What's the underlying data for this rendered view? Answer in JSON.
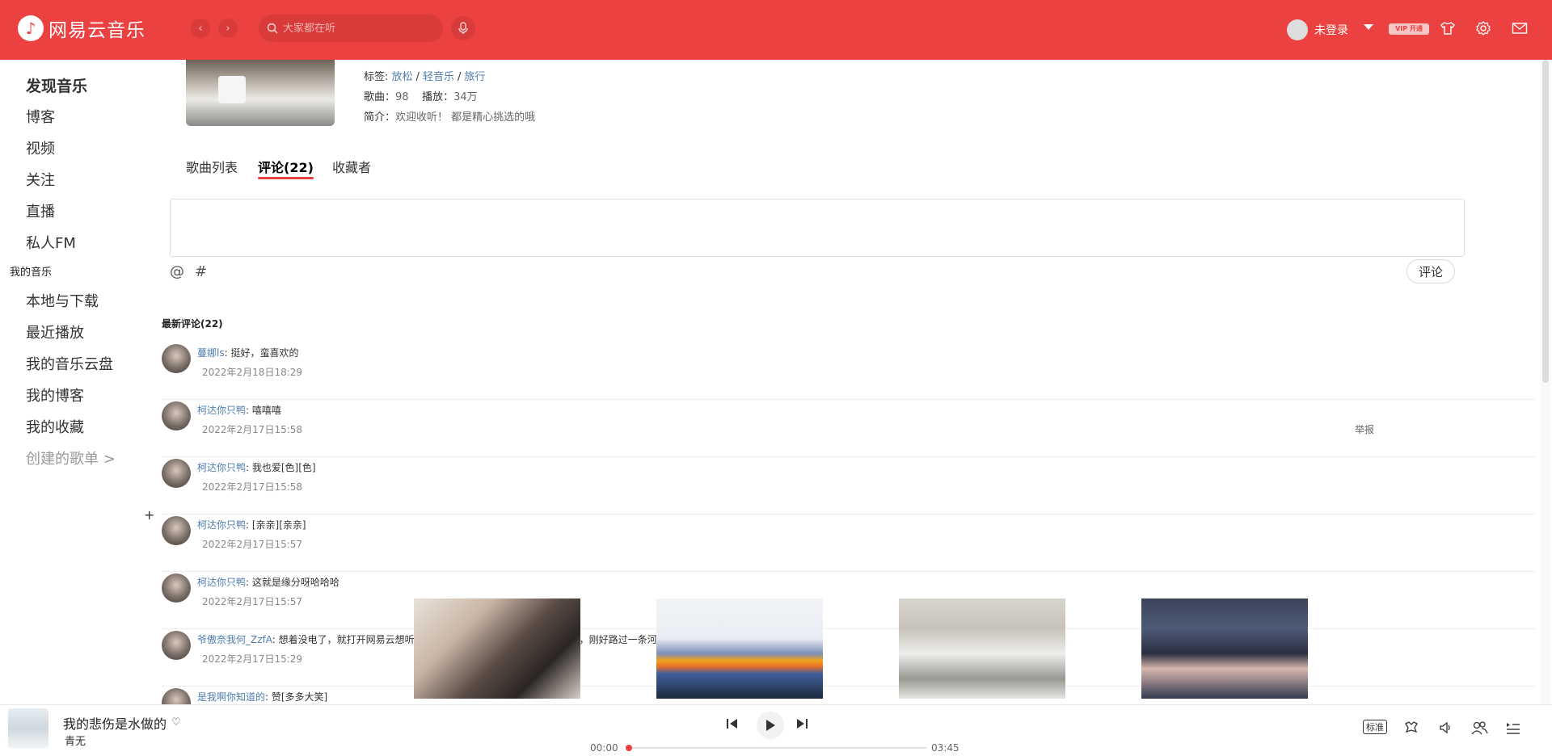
{
  "app": {
    "name": "网易云音乐",
    "brand_color": "#ec4141"
  },
  "header": {
    "search_placeholder": "大家都在听",
    "user_label": "未登录",
    "vip_label": "开通"
  },
  "sidebar": {
    "items": [
      {
        "label": "发现音乐"
      },
      {
        "label": "博客"
      },
      {
        "label": "视频"
      },
      {
        "label": "关注"
      },
      {
        "label": "直播"
      },
      {
        "label": "私人FM"
      }
    ],
    "my_music_label": "我的音乐",
    "my_items": [
      {
        "label": "本地与下载"
      },
      {
        "label": "最近播放"
      },
      {
        "label": "我的音乐云盘"
      },
      {
        "label": "我的博客"
      },
      {
        "label": "我的收藏"
      }
    ],
    "created_label": "创建的歌单 >",
    "add_label": "+"
  },
  "playlist": {
    "tags_label": "标签:",
    "tags": [
      "放松",
      "轻音乐",
      "旅行"
    ],
    "songs_label": "歌曲：",
    "songs": "98",
    "plays_label": "播放：",
    "plays": "34万",
    "intro_label": "简介：",
    "intro": "欢迎收听！ 都是精心挑选的哦"
  },
  "tabs": [
    {
      "label": "歌曲列表"
    },
    {
      "label": "评论(22)"
    },
    {
      "label": "收藏者"
    }
  ],
  "comment_form": {
    "at": "@",
    "hash": "#",
    "submit_label": "评论"
  },
  "comments_title": "最新评论(22)",
  "comments": [
    {
      "user": "蔓娜ls",
      "text": "挺好，蛮喜欢的",
      "time": "2022年2月18日18:29",
      "report": ""
    },
    {
      "user": "柯达你只鸭",
      "text": "嘻嘻嘻",
      "time": "2022年2月17日15:58",
      "report": "举报"
    },
    {
      "user": "柯达你只鸭",
      "text": "我也爱[色][色]",
      "time": "2022年2月17日15:58",
      "report": ""
    },
    {
      "user": "柯达你只鸭",
      "text": "[亲亲][亲亲]",
      "time": "2022年2月17日15:57",
      "report": ""
    },
    {
      "user": "柯达你只鸭",
      "text": "这就是缘分呀哈哈哈",
      "time": "2022年2月17日15:57",
      "report": ""
    },
    {
      "user": "爷傲奈我何_ZzfA",
      "text": "想着没电了，就打开网易云想听会儿歌，当第二首歌欢流声响起的时候，刚好路过一条河",
      "time": "2022年2月17日15:29",
      "report": ""
    },
    {
      "user": "是我啊你知道的",
      "text": "赞[多多大笑]",
      "time": "",
      "report": ""
    }
  ],
  "player": {
    "song_title": "我的悲伤是水做的",
    "artist": "青无",
    "current_time": "00:00",
    "total_time": "03:45",
    "progress": 0,
    "quality_label": "标准"
  }
}
